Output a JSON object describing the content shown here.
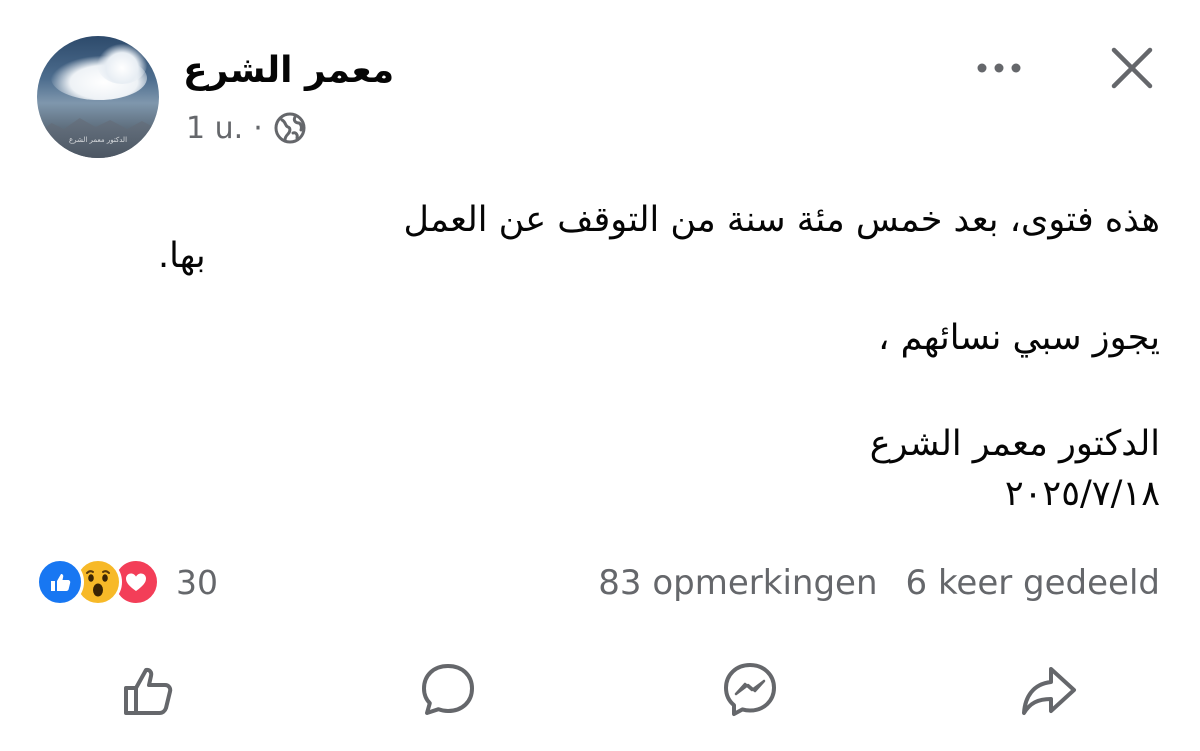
{
  "post": {
    "author": "معمر الشرع",
    "time": "1 u.",
    "separator": "·",
    "privacy_icon": "globe-icon",
    "avatar_caption": "الدكتور معمر الشرع",
    "body_lines": [
      "هذه فتوى، بعد خمس مئة سنة من التوقف عن العمل",
      "بها.",
      "يجوز سبي نسائهم ،",
      "الدكتور معمر الشرع",
      "٢٠٢٥/٧/١٨"
    ]
  },
  "header_actions": {
    "more_icon": "more-dots-icon",
    "close_icon": "close-icon"
  },
  "stats": {
    "reaction_icons": [
      "like-reaction-icon",
      "wow-reaction-icon",
      "love-reaction-icon"
    ],
    "reaction_count": "30",
    "comments": "83 opmerkingen",
    "shares": "6 keer gedeeld"
  },
  "actions": {
    "icons": [
      "like-icon",
      "comment-icon",
      "messenger-icon",
      "share-icon"
    ]
  },
  "colors": {
    "text": "#050505",
    "secondary": "#65676b",
    "like_blue": "#1877f2",
    "wow_yellow": "#f7b928",
    "love_red": "#f33e58"
  }
}
